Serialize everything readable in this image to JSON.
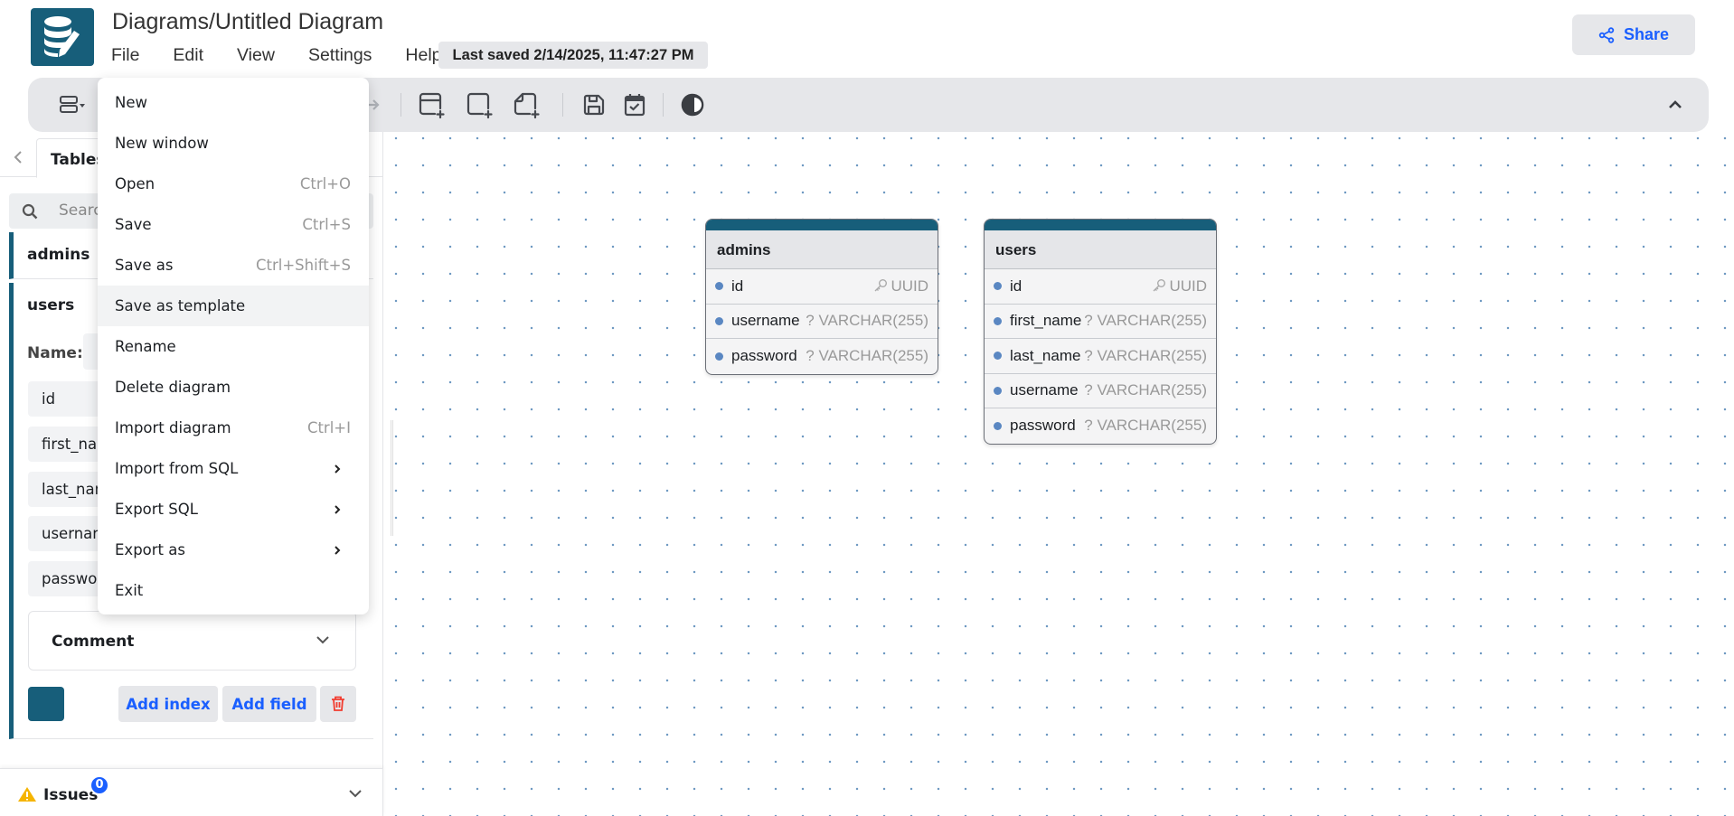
{
  "header": {
    "title": "Diagrams/Untitled Diagram",
    "menus": [
      "File",
      "Edit",
      "View",
      "Settings",
      "Help"
    ],
    "last_saved": "Last saved 2/14/2025, 11:47:27 PM",
    "share_label": "Share"
  },
  "toolbar": {
    "icons": [
      "layout-icon",
      "redo-icon",
      "add-table-icon",
      "add-area-icon",
      "add-note-icon",
      "save-icon",
      "todo-icon",
      "theme-icon",
      "collapse-icon"
    ]
  },
  "sidebar": {
    "tab": "Tables",
    "search_placeholder": "Search...",
    "tables": [
      {
        "name": "admins"
      },
      {
        "name": "users",
        "name_label": "Name:",
        "fields": [
          "id",
          "first_name",
          "last_name",
          "username",
          "password"
        ],
        "comment_label": "Comment",
        "color": "#175e7a",
        "add_index": "Add index",
        "add_field": "Add field"
      }
    ],
    "issues_label": "Issues",
    "issues_count": "0"
  },
  "file_menu": {
    "items": [
      {
        "label": "New",
        "shortcut": ""
      },
      {
        "label": "New window",
        "shortcut": ""
      },
      {
        "label": "Open",
        "shortcut": "Ctrl+O"
      },
      {
        "label": "Save",
        "shortcut": "Ctrl+S"
      },
      {
        "label": "Save as",
        "shortcut": "Ctrl+Shift+S"
      },
      {
        "label": "Save as template",
        "shortcut": "",
        "hover": true
      },
      {
        "label": "Rename",
        "shortcut": ""
      },
      {
        "label": "Delete diagram",
        "shortcut": ""
      },
      {
        "label": "Import diagram",
        "shortcut": "Ctrl+I"
      },
      {
        "label": "Import from SQL",
        "shortcut": "",
        "submenu": true
      },
      {
        "label": "Export SQL",
        "shortcut": "",
        "submenu": true
      },
      {
        "label": "Export as",
        "shortcut": "",
        "submenu": true
      },
      {
        "label": "Exit",
        "shortcut": ""
      }
    ]
  },
  "canvas": {
    "tables": [
      {
        "name": "admins",
        "fields": [
          {
            "name": "id",
            "type": "UUID",
            "pk": true
          },
          {
            "name": "username",
            "type": "? VARCHAR(255)"
          },
          {
            "name": "password",
            "type": "? VARCHAR(255)"
          }
        ]
      },
      {
        "name": "users",
        "fields": [
          {
            "name": "id",
            "type": "UUID",
            "pk": true
          },
          {
            "name": "first_name",
            "type": "? VARCHAR(255)"
          },
          {
            "name": "last_name",
            "type": "? VARCHAR(255)"
          },
          {
            "name": "username",
            "type": "? VARCHAR(255)"
          },
          {
            "name": "password",
            "type": "? VARCHAR(255)"
          }
        ]
      }
    ]
  },
  "colors": {
    "brand": "#175e7a",
    "accent": "#1a5fff"
  }
}
